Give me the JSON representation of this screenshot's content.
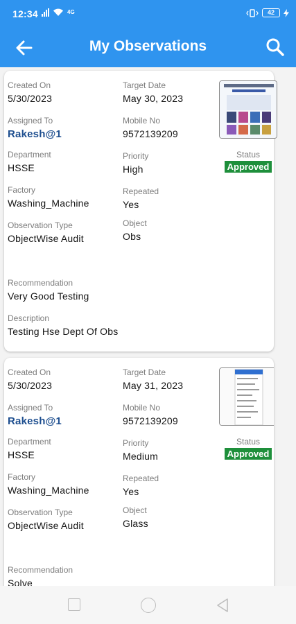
{
  "status_bar": {
    "time": "12:34",
    "network_label": "4G",
    "battery_level": "42"
  },
  "app_bar": {
    "title": "My Observations",
    "back_icon": "arrow-left-icon",
    "search_icon": "search-icon"
  },
  "observations": [
    {
      "created_on_label": "Created On",
      "created_on": "5/30/2023",
      "target_date_label": "Target Date",
      "target_date": "May 30, 2023",
      "assigned_to_label": "Assigned To",
      "assigned_to": "Rakesh@1",
      "mobile_no_label": "Mobile No",
      "mobile_no": "9572139209",
      "department_label": "Department",
      "department": "HSSE",
      "priority_label": "Priority",
      "priority": "High",
      "status_label": "Status",
      "status": "Approved",
      "factory_label": "Factory",
      "factory": "Washing_Machine",
      "repeated_label": "Repeated",
      "repeated": "Yes",
      "observation_type_label": "Observation Type",
      "observation_type": "ObjectWise Audit",
      "object_label": "Object",
      "object": "Obs",
      "recommendation_label": "Recommendation",
      "recommendation": "Very Good Testing",
      "description_label": "Description",
      "description": "Testing Hse Dept Of Obs"
    },
    {
      "created_on_label": "Created On",
      "created_on": "5/30/2023",
      "target_date_label": "Target Date",
      "target_date": "May 31, 2023",
      "assigned_to_label": "Assigned To",
      "assigned_to": "Rakesh@1",
      "mobile_no_label": "Mobile No",
      "mobile_no": "9572139209",
      "department_label": "Department",
      "department": "HSSE",
      "priority_label": "Priority",
      "priority": "Medium",
      "status_label": "Status",
      "status": "Approved",
      "factory_label": "Factory",
      "factory": "Washing_Machine",
      "repeated_label": "Repeated",
      "repeated": "Yes",
      "observation_type_label": "Observation Type",
      "observation_type": "ObjectWise Audit",
      "object_label": "Object",
      "object": "Glass",
      "recommendation_label": "Recommendation",
      "recommendation": "Solve"
    }
  ],
  "colors": {
    "app_bar": "#2f94ef",
    "status_approved": "#1e8f3b",
    "assigned_link": "#1d4e8f"
  },
  "nav_bar": {
    "recents_icon": "square-icon",
    "home_icon": "circle-icon",
    "back_icon": "triangle-back-icon"
  }
}
